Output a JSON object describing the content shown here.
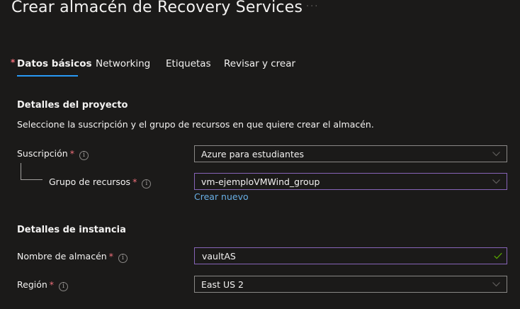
{
  "header": {
    "title": "Crear almacén de Recovery Services",
    "more": "···"
  },
  "tabs": [
    {
      "label": "Datos básicos",
      "required_marker": "*",
      "active": true
    },
    {
      "label": "Networking"
    },
    {
      "label": "Etiquetas"
    },
    {
      "label": "Revisar y crear"
    }
  ],
  "project": {
    "title": "Detalles del proyecto",
    "description": "Seleccione la suscripción y el grupo de recursos en que quiere crear el almacén.",
    "subscription": {
      "label": "Suscripción",
      "required": "*",
      "value": "Azure para estudiantes"
    },
    "resource_group": {
      "label": "Grupo de recursos",
      "required": "*",
      "value": "vm-ejemploVMWind_group",
      "create_link": "Crear nuevo"
    }
  },
  "instance": {
    "title": "Detalles de instancia",
    "vault_name": {
      "label": "Nombre de almacén",
      "required": "*",
      "value": "vaultAS"
    },
    "region": {
      "label": "Región",
      "required": "*",
      "value": "East US 2"
    }
  },
  "info_glyph": "i",
  "colors": {
    "background": "#1b1a19",
    "accent": "#2899f5",
    "required": "#f1707b",
    "link": "#69afe5",
    "focus_border": "#8764b8",
    "valid_check": "#57a300"
  }
}
